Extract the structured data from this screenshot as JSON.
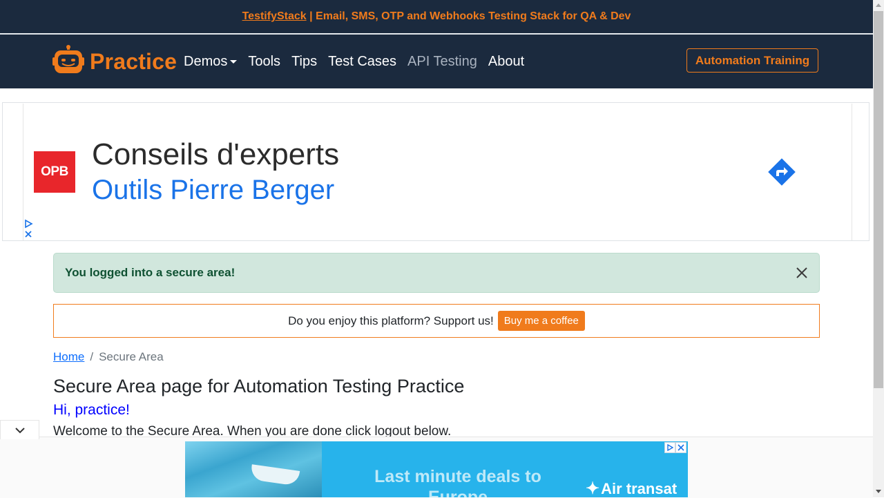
{
  "promo": {
    "link_text": "TestifyStack",
    "rest_text": " | Email, SMS, OTP and Webhooks Testing Stack for QA & Dev"
  },
  "navbar": {
    "brand": "Practice",
    "brand_icon": "robot-icon",
    "links": [
      {
        "label": "Demos",
        "dropdown": true
      },
      {
        "label": "Tools"
      },
      {
        "label": "Tips"
      },
      {
        "label": "Test Cases"
      },
      {
        "label": "API Testing"
      },
      {
        "label": "About"
      }
    ],
    "cta": "Automation Training"
  },
  "ad_banner": {
    "logo_text": "OPB",
    "title": "Conseils d'experts",
    "subtitle": "Outils Pierre Berger",
    "arrow_icon": "directions-arrow-icon"
  },
  "alert": {
    "message": "You logged into a secure area!",
    "close_icon": "close-icon"
  },
  "support": {
    "text": "Do you enjoy this platform? Support us!",
    "button": "Buy me a coffee"
  },
  "breadcrumb": {
    "home": "Home",
    "separator": "/",
    "current": "Secure Area"
  },
  "content": {
    "title": "Secure Area page for Automation Testing Practice",
    "greeting": "Hi, practice!",
    "welcome": "Welcome to the Secure Area. When you are done click logout below."
  },
  "bottom_ad": {
    "headline": "Last minute deals to Europe",
    "brand": "Air transat"
  },
  "colors": {
    "accent": "#f07b1c",
    "navbar_bg": "#1b2a3e",
    "alert_bg": "#d1e7dd",
    "link": "#0d6efd",
    "greeting": "#0000ff"
  }
}
